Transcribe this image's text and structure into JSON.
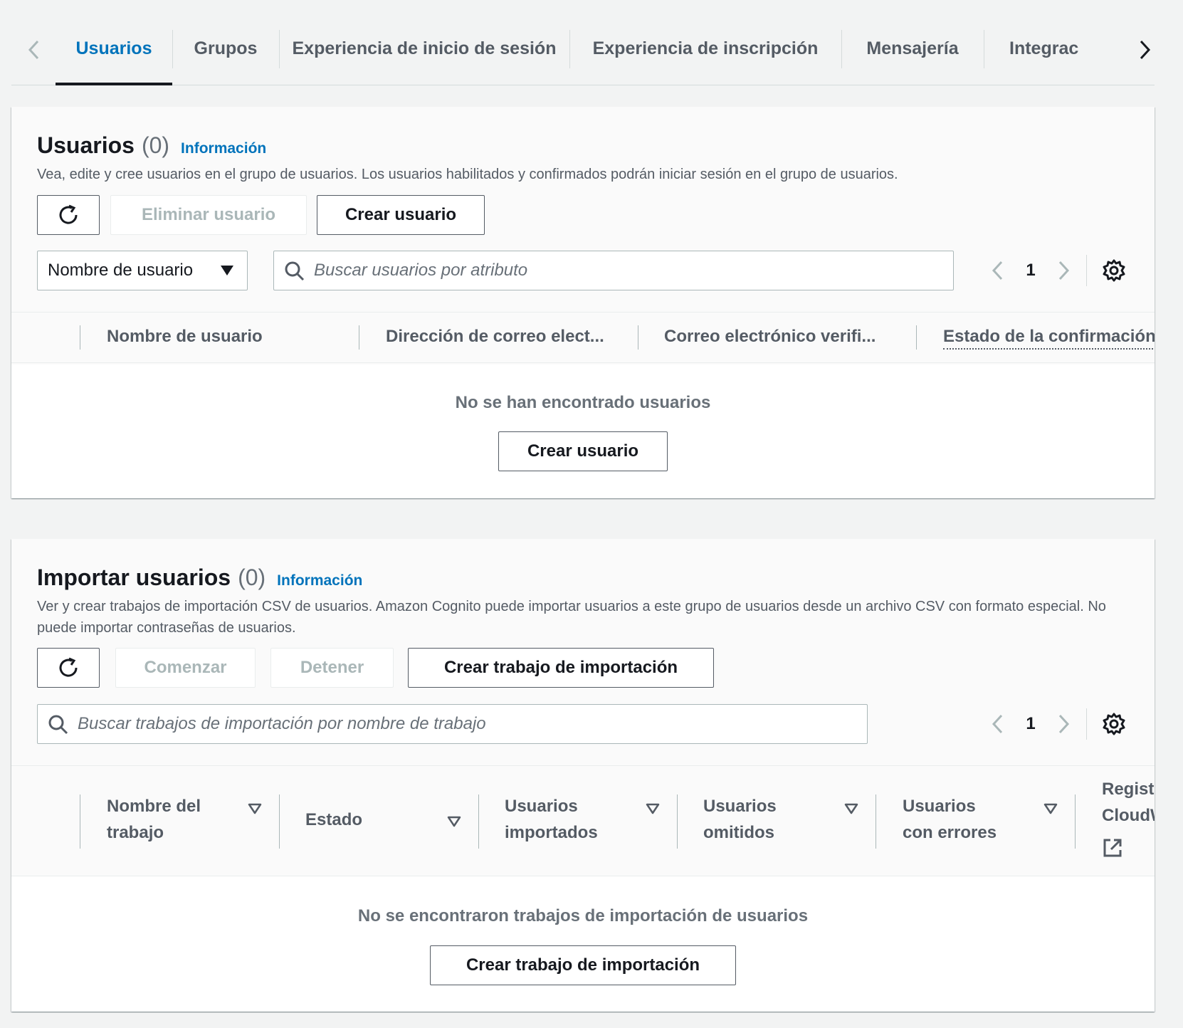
{
  "tabs": {
    "items": [
      {
        "label": "Usuarios",
        "active": true
      },
      {
        "label": "Grupos"
      },
      {
        "label": "Experiencia de inicio de sesión"
      },
      {
        "label": "Experiencia de inscripción"
      },
      {
        "label": "Mensajería"
      },
      {
        "label": "Integrac"
      }
    ]
  },
  "users_panel": {
    "title": "Usuarios",
    "count": "(0)",
    "info_link": "Información",
    "description": "Vea, edite y cree usuarios en el grupo de usuarios. Los usuarios habilitados y confirmados podrán iniciar sesión en el grupo de usuarios.",
    "delete_button": "Eliminar usuario",
    "create_button": "Crear usuario",
    "attribute_select": "Nombre de usuario",
    "search_placeholder": "Buscar usuarios por atributo",
    "page": "1",
    "columns": [
      "Nombre de usuario",
      "Dirección de correo elect...",
      "Correo electrónico verifi...",
      "Estado de la confirmación"
    ],
    "empty_text": "No se han encontrado usuarios",
    "empty_create_button": "Crear usuario"
  },
  "import_panel": {
    "title": "Importar usuarios",
    "count": "(0)",
    "info_link": "Información",
    "description": "Ver y crear trabajos de importación CSV de usuarios. Amazon Cognito puede importar usuarios a este grupo de usuarios desde un archivo CSV con formato especial. No puede importar contraseñas de usuarios.",
    "start_button": "Comenzar",
    "stop_button": "Detener",
    "create_button": "Crear trabajo de importación",
    "search_placeholder": "Buscar trabajos de importación por nombre de trabajo",
    "page": "1",
    "columns": [
      "Nombre del trabajo",
      "Estado",
      "Usuarios importados",
      "Usuarios omitidos",
      "Usuarios con errores",
      "Regist CloudW"
    ],
    "empty_text": "No se encontraron trabajos de importación de usuarios",
    "empty_create_button": "Crear trabajo de importación"
  },
  "colors": {
    "accent": "#0073bb",
    "text": "#16191f",
    "muted": "#545b64",
    "background": "#f2f3f3"
  }
}
